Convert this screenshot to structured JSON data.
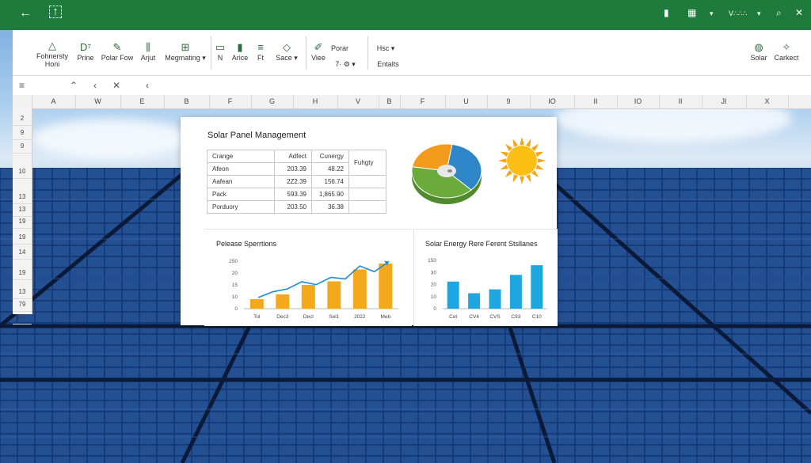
{
  "titlebar": {
    "back_icon": "back-arrow-icon",
    "app_icon": "excel-file-icon",
    "right_label": "V∴∴∴",
    "colors": {
      "bar": "#1e7b3c"
    }
  },
  "ribbon": {
    "items": [
      {
        "label": "Fohnersty\nHoni",
        "icon": "triangle-icon"
      },
      {
        "label": "Prine",
        "icon": "format-icon"
      },
      {
        "label": "Polar Fow",
        "icon": "pen-icon"
      },
      {
        "label": "Arjut",
        "icon": "chart-icon"
      },
      {
        "label": "Megmating",
        "icon": "table-icon"
      },
      {
        "label": "N",
        "icon": "layout-icon"
      },
      {
        "label": "Arice",
        "icon": "page-icon"
      },
      {
        "label": "Ft",
        "icon": "insert-icon"
      },
      {
        "label": "Sace",
        "icon": "diamond-icon"
      },
      {
        "label": "Viee",
        "icon": "pencil-icon"
      },
      {
        "label": "Porar",
        "icon": ""
      },
      {
        "label": "7·",
        "icon": ""
      },
      {
        "label": "Hsc",
        "icon": ""
      },
      {
        "label": "Entalts",
        "icon": ""
      },
      {
        "label": "Solar",
        "icon": "lightbulb-icon"
      },
      {
        "label": "Carkect",
        "icon": "pin-icon"
      }
    ]
  },
  "columns": [
    "A",
    "W",
    "E",
    "B",
    "F",
    "G",
    "H",
    "V",
    "B",
    "F",
    "U",
    "9",
    "IO",
    "II",
    "IO",
    "II",
    "JI",
    "X"
  ],
  "rows": [
    "2",
    "9",
    "9",
    "10",
    "13",
    "13",
    "19",
    "19",
    "14",
    "19",
    "13",
    "79",
    "97"
  ],
  "dashboard": {
    "title": "Solar Panel Management",
    "table": {
      "headers": [
        "Crange",
        "Adfect",
        "Cunergy",
        "Fuhgty"
      ],
      "rows": [
        [
          "Afeon",
          "203.39",
          "48.22"
        ],
        [
          "Aafean",
          "2Z2.39",
          "156.74"
        ],
        [
          "Pack",
          "593.39",
          "1,865.90"
        ],
        [
          "Porduory",
          "203.50",
          "36.38"
        ]
      ]
    },
    "pie_icon": "pie-chart-icon",
    "sun_icon": "sun-icon",
    "panel_a_title": "Pelease Sperrtions",
    "panel_b_title": "Solar Energy Rere Ferent Stsllanes"
  },
  "chart_data": [
    {
      "type": "bar",
      "title": "Pelease Sperrtions",
      "categories": [
        "Tol",
        "Dec3",
        "Decl",
        "Sel1",
        "2022",
        "Meb"
      ],
      "values": [
        8,
        12,
        20,
        23,
        33,
        38
      ],
      "yticks": [
        "250",
        "20",
        "15",
        "10",
        "0"
      ],
      "ylim": [
        0,
        40
      ],
      "overlay_line": [
        0,
        8,
        12,
        22,
        18,
        28,
        26,
        44,
        36,
        50
      ],
      "colors": {
        "bars": "#f4a81c",
        "line": "#1f8ed6"
      }
    },
    {
      "type": "bar",
      "title": "Solar Energy Rere Ferent Stsllanes",
      "categories": [
        "Cet",
        "CV4",
        "CVS",
        "C93",
        "C10"
      ],
      "values": [
        28,
        16,
        20,
        35,
        45
      ],
      "yticks": [
        "150",
        "30",
        "20",
        "10",
        "0"
      ],
      "ylim": [
        0,
        50
      ],
      "colors": {
        "bars": "#1ea6e0"
      }
    },
    {
      "type": "pie",
      "values": [
        25,
        35,
        40
      ],
      "colors": [
        "#f39a1c",
        "#2e86c9",
        "#6aab3c"
      ]
    }
  ]
}
